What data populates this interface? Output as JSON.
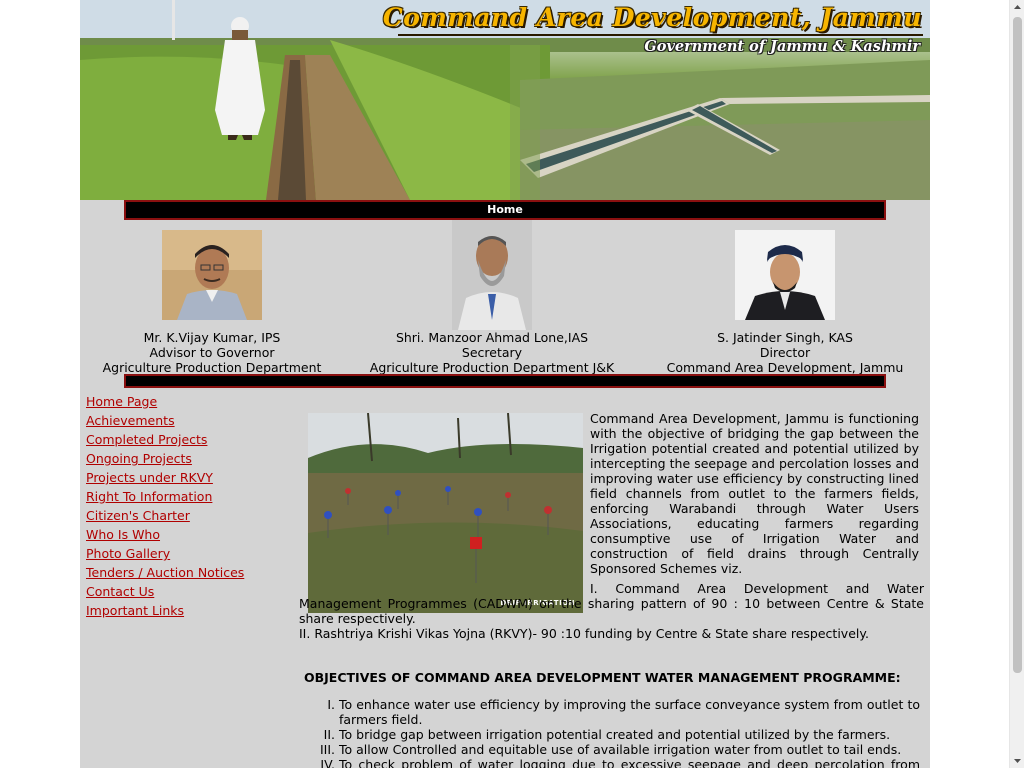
{
  "banner": {
    "title": "Command Area Development, Jammu",
    "subtitle": "Government of Jammu & Kashmir"
  },
  "nav": {
    "home": "Home"
  },
  "officials": [
    {
      "name": "Mr. K.Vijay Kumar, IPS",
      "role": "Advisor to Governor",
      "dept": "Agriculture Production Department"
    },
    {
      "name": "Shri. Manzoor Ahmad Lone,IAS",
      "role": "Secretary",
      "dept": "Agriculture Production Department J&K"
    },
    {
      "name": "S. Jatinder Singh, KAS",
      "role": "Director",
      "dept": "Command Area Development, Jammu"
    }
  ],
  "sidebar": {
    "links": [
      "Home Page",
      "Achievements",
      "Completed Projects",
      "Ongoing Projects",
      "Projects under RKVY",
      "Right To Information",
      "Citizen's Charter",
      "Who Is Who",
      "Photo Gallery",
      "Tenders / Auction Notices",
      "Contact Us",
      "Important Links"
    ]
  },
  "content": {
    "image_caption": "DRIP IRRIGATION",
    "intro": "Command Area Development, Jammu is functioning with the objective of bridging the gap between the Irrigation potential created and potential utilized by intercepting the seepage and percolation losses and improving water use efficiency by constructing lined field channels from outlet to the farmers fields, enforcing Warabandi through Water Users Associations, educating farmers regarding consumptive use of Irrigation Water and construction of field drains through Centrally Sponsored Schemes viz.",
    "point1": "I. Command Area Development and Water Management Programmes (CADWM) on the sharing pattern of 90 : 10 between Centre & State share respectively.",
    "point2": "II. Rashtriya Krishi Vikas Yojna (RKVY)- 90 :10 funding by Centre & State share respectively.",
    "objectives_title": "OBJECTIVES OF COMMAND AREA DEVELOPMENT WATER MANAGEMENT PROGRAMME:",
    "objectives": [
      {
        "num": "I.",
        "text": "To enhance water use efficiency by improving the surface conveyance system from outlet to farmers field."
      },
      {
        "num": "II.",
        "text": "To bridge gap between irrigation potential created and potential utilized by the farmers."
      },
      {
        "num": "III.",
        "text": "To allow Controlled and equitable use of available irrigation water from outlet to tail ends."
      },
      {
        "num": "IV.",
        "text": "To check problem of water logging due to excessive seepage and deep percolation from upper"
      }
    ]
  },
  "colors": {
    "page_bg": "#d4d4d4",
    "link": "#b00000",
    "title_gold": "#f7b500",
    "bar": "#000000",
    "bar_border": "#8a1010"
  }
}
